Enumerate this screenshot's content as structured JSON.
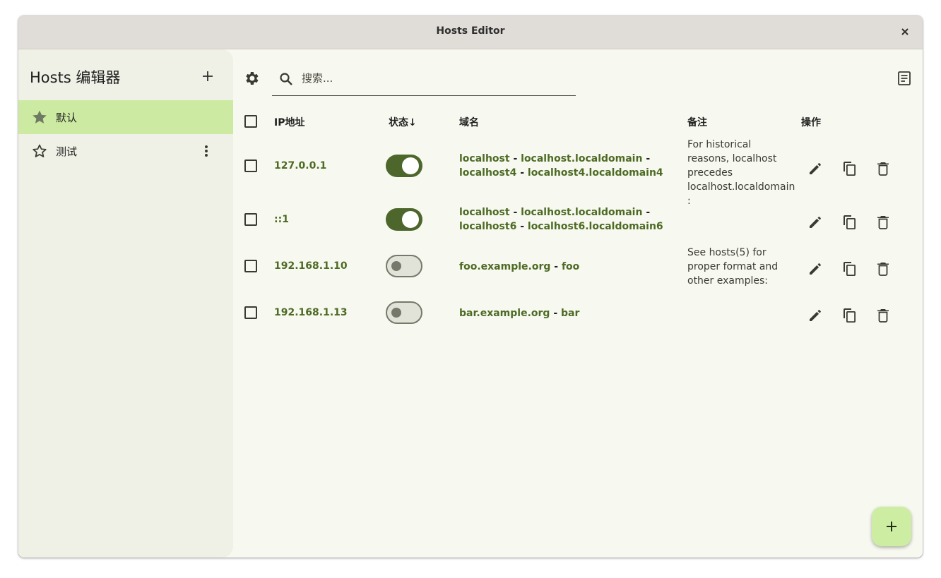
{
  "window": {
    "title": "Hosts Editor"
  },
  "sidebar": {
    "app_title": "Hosts 编辑器",
    "profiles": [
      {
        "label": "默认",
        "selected": true,
        "icon": "star-filled-icon"
      },
      {
        "label": "测试",
        "selected": false,
        "icon": "star-outline-icon"
      }
    ]
  },
  "search": {
    "placeholder": "搜索...",
    "value": ""
  },
  "table": {
    "headers": {
      "ip": "IP地址",
      "status": "状态",
      "domain": "域名",
      "note": "备注",
      "actions": "操作"
    },
    "sort_indicator": "↓",
    "rows": [
      {
        "ip": "127.0.0.1",
        "enabled": true,
        "domains": [
          "localhost",
          "localhost.localdomain",
          "localhost4",
          "localhost4.localdomain4"
        ],
        "note": "For historical reasons, localhost precedes localhost.localdomain :"
      },
      {
        "ip": "::1",
        "enabled": true,
        "domains": [
          "localhost",
          "localhost.localdomain",
          "localhost6",
          "localhost6.localdomain6"
        ],
        "note": ""
      },
      {
        "ip": "192.168.1.10",
        "enabled": false,
        "domains": [
          "foo.example.org",
          "foo"
        ],
        "note": "See hosts(5) for proper format and other examples:"
      },
      {
        "ip": "192.168.1.13",
        "enabled": false,
        "domains": [
          "bar.example.org",
          "bar"
        ],
        "note": ""
      }
    ]
  },
  "colors": {
    "accent": "#4c662b",
    "selection": "#cdeaa3",
    "background": "#f7f8ef",
    "sidebar": "#f0f1e6"
  }
}
